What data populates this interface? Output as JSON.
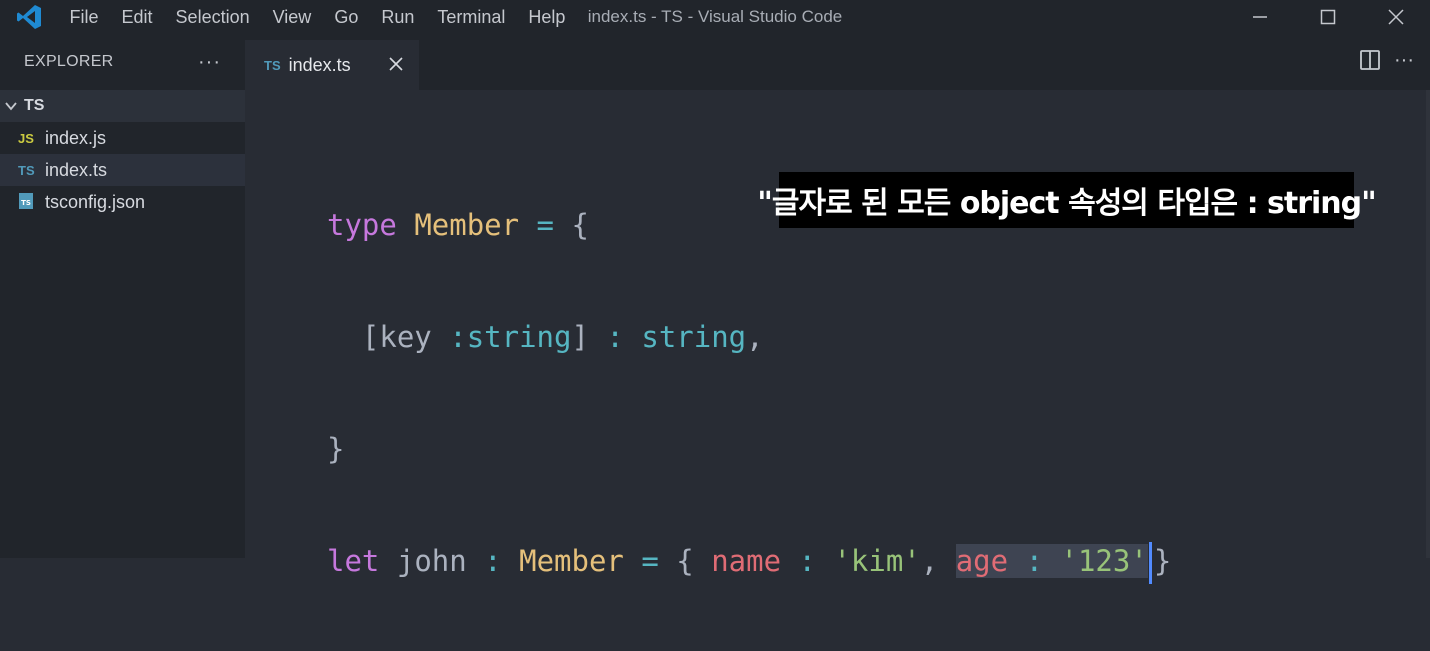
{
  "app": {
    "window_title": "index.ts - TS - Visual Studio Code",
    "menu": [
      "File",
      "Edit",
      "Selection",
      "View",
      "Go",
      "Run",
      "Terminal",
      "Help"
    ]
  },
  "sidebar": {
    "title": "EXPLORER",
    "more": "···",
    "folder": "TS",
    "files": [
      {
        "badge": "JS",
        "badge_color": "#cbcb41",
        "name": "index.js",
        "active": false
      },
      {
        "badge": "TS",
        "badge_color": "#519aba",
        "name": "index.ts",
        "active": true
      },
      {
        "badge": "TS",
        "badge_color": "#519aba",
        "name": "tsconfig.json",
        "active": false
      }
    ]
  },
  "tab": {
    "badge": "TS",
    "name": "index.ts"
  },
  "editor": {
    "line1": {
      "kw": "type",
      "name": "Member",
      "eq": "=",
      "brace": "{"
    },
    "line2": {
      "open": "[",
      "key": "key",
      "colon": ":",
      "type": "string",
      "close": "]",
      "colon2": ":",
      "value_type": "string",
      "comma": ","
    },
    "line3": {
      "brace": "}"
    },
    "line4": {
      "kw": "let",
      "var": "john",
      "colon": ":",
      "type": "Member",
      "eq": "=",
      "open": "{",
      "p1": "name",
      "c1": ":",
      "v1": "'kim'",
      "comma": ",",
      "p2": "age",
      "c2": ":",
      "v2": "'123'",
      "close": "}"
    }
  },
  "caption": "\"글자로 된 모든 object 속성의 타입은 : string\"",
  "colors": {
    "accent": "#528bff",
    "background": "#282c34",
    "sidebar": "#21252b"
  }
}
